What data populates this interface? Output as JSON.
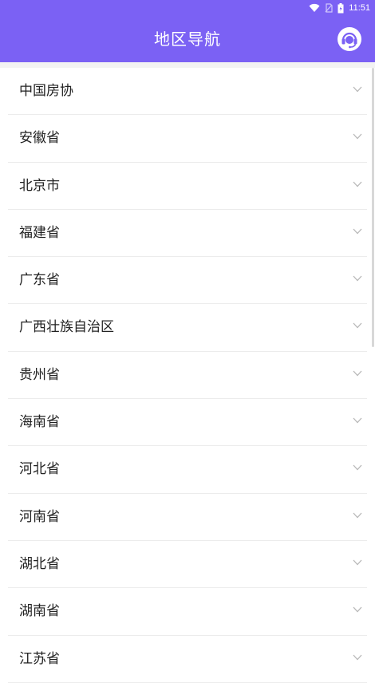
{
  "status": {
    "time": "11:51"
  },
  "header": {
    "title": "地区导航"
  },
  "regions": [
    {
      "label": "中国房协"
    },
    {
      "label": "安徽省"
    },
    {
      "label": "北京市"
    },
    {
      "label": "福建省"
    },
    {
      "label": "广东省"
    },
    {
      "label": "广西壮族自治区"
    },
    {
      "label": "贵州省"
    },
    {
      "label": "海南省"
    },
    {
      "label": "河北省"
    },
    {
      "label": "河南省"
    },
    {
      "label": "湖北省"
    },
    {
      "label": "湖南省"
    },
    {
      "label": "江苏省"
    }
  ],
  "colors": {
    "accent": "#7b61f4"
  },
  "icons": {
    "support": "headset-icon",
    "expand": "chevron-down-icon"
  }
}
